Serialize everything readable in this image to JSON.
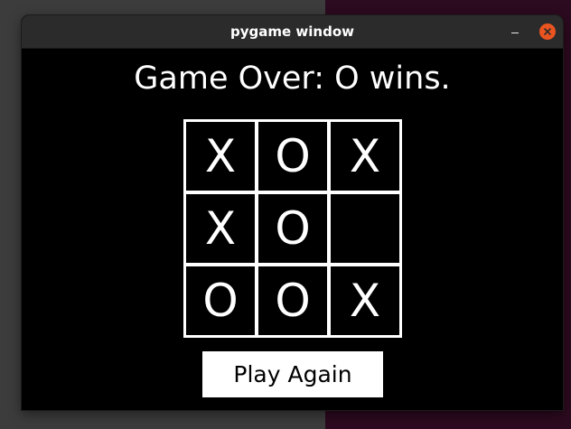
{
  "window": {
    "title": "pygame window"
  },
  "game": {
    "status": "Game Over: O wins.",
    "board": [
      [
        "X",
        "O",
        "X"
      ],
      [
        "X",
        "O",
        ""
      ],
      [
        "O",
        "O",
        "X"
      ]
    ],
    "play_again_label": "Play Again"
  },
  "titlebar_icons": {
    "minimize": "minimize-icon",
    "close": "close-icon"
  },
  "colors": {
    "desktop": "#3c3c3c",
    "desktop_right": "#2c0a1f",
    "titlebar": "#2b2b2b",
    "close_button": "#e95420",
    "game_background": "#000000",
    "foreground": "#ffffff"
  }
}
